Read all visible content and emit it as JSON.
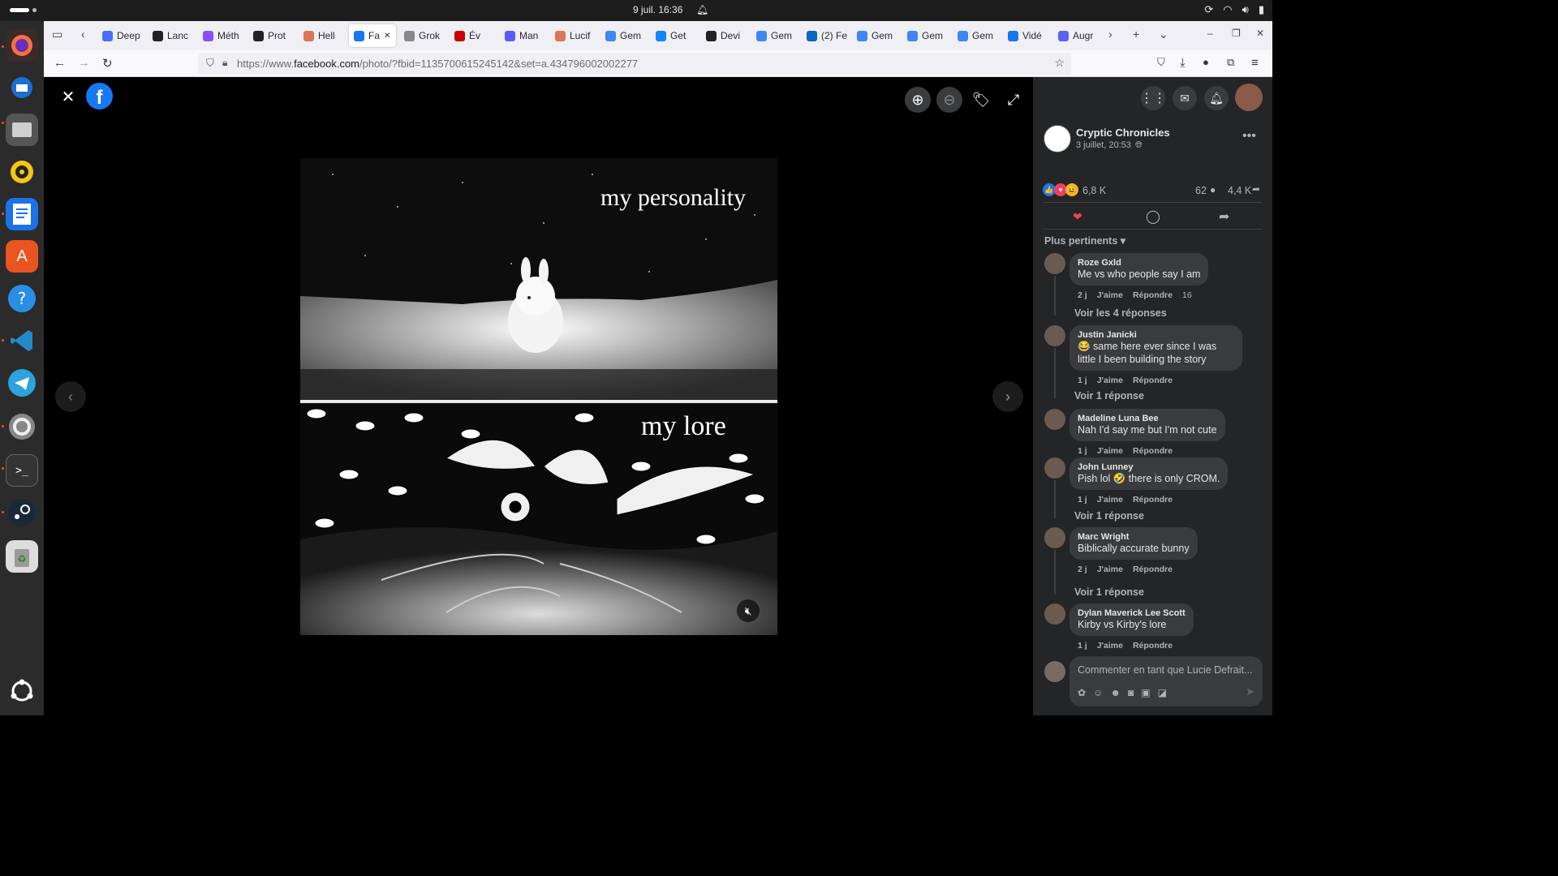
{
  "topbar": {
    "date_time": "9 juil.  16:36"
  },
  "browser": {
    "tabs": [
      {
        "label": "Deep",
        "icon": "deepseek-icon",
        "color": "#4d6bfe"
      },
      {
        "label": "Lanc",
        "icon": "lance-icon",
        "color": "#222"
      },
      {
        "label": "Méth",
        "icon": "circle-icon",
        "color": "#8a4dff"
      },
      {
        "label": "Prot",
        "icon": "proton-icon",
        "color": "#222"
      },
      {
        "label": "Hell",
        "icon": "claude-icon",
        "color": "#d97757"
      },
      {
        "label": "Fa",
        "icon": "facebook-icon",
        "color": "#1877f2"
      },
      {
        "label": "Grok",
        "icon": "grok-icon",
        "color": "#888"
      },
      {
        "label": "Év",
        "icon": "event-icon",
        "color": "#c00"
      },
      {
        "label": "Man",
        "icon": "mistral-icon",
        "color": "#5a5aff"
      },
      {
        "label": "Lucif",
        "icon": "claude-icon",
        "color": "#d97757"
      },
      {
        "label": "Gem",
        "icon": "google-icon",
        "color": "#4285f4"
      },
      {
        "label": "Get",
        "icon": "bluesky-icon",
        "color": "#1185fe"
      },
      {
        "label": "Devi",
        "icon": "github-icon",
        "color": "#222"
      },
      {
        "label": "Gem",
        "icon": "google-icon",
        "color": "#4285f4"
      },
      {
        "label": "(2) Fe",
        "icon": "linkedin-icon",
        "color": "#0a66c2"
      },
      {
        "label": "Gem",
        "icon": "google-icon",
        "color": "#4285f4"
      },
      {
        "label": "Gem",
        "icon": "google-icon",
        "color": "#4285f4"
      },
      {
        "label": "Gem",
        "icon": "google-icon",
        "color": "#4285f4"
      },
      {
        "label": "Vidé",
        "icon": "facebook-icon",
        "color": "#1877f2"
      },
      {
        "label": "Augr",
        "icon": "discord-icon",
        "color": "#5865f2"
      }
    ],
    "url_prefix": "https://www.",
    "url_domain": "facebook.com",
    "url_path": "/photo/?fbid=1135700615245142&set=a.434796002002277"
  },
  "photo": {
    "top_caption": "my personality",
    "bottom_caption": "my lore"
  },
  "post": {
    "page_name": "Cryptic Chronicles",
    "date": "3 juillet, 20:53",
    "reactions_count": "6,8 K",
    "comments_count": "62",
    "shares_count": "4,4 K",
    "sort_label": "Plus pertinents",
    "comment_placeholder": "Commenter en tant que Lucie Defrait..."
  },
  "comments": [
    {
      "name": "Roze Gxld",
      "text": "Me vs who people say I am",
      "age": "2 j",
      "like": "J'aime",
      "reply": "Répondre",
      "reaction_count": "16",
      "more": "Voir les 4 réponses"
    },
    {
      "name": "Justin Janicki",
      "text": "😂 same here ever since I was little I been building the story",
      "age": "1 j",
      "like": "J'aime",
      "reply": "Répondre",
      "more": "Voir 1 réponse"
    },
    {
      "name": "Madeline Luna Bee",
      "text": "Nah I'd say me but I'm not cute",
      "age": "1 j",
      "like": "J'aime",
      "reply": "Répondre"
    },
    {
      "name": "John Lunney",
      "text": "Pish lol 🤣 there is only CROM.",
      "age": "1 j",
      "like": "J'aime",
      "reply": "Répondre",
      "more": "Voir 1 réponse"
    },
    {
      "name": "Marc Wright",
      "text": "Biblically accurate bunny",
      "age": "2 j",
      "like": "J'aime",
      "reply": "Répondre",
      "more": "Voir 1 réponse"
    },
    {
      "name": "Dylan Maverick Lee Scott",
      "text": "Kirby vs Kirby's lore",
      "age": "1 j",
      "like": "J'aime",
      "reply": "Répondre"
    }
  ]
}
